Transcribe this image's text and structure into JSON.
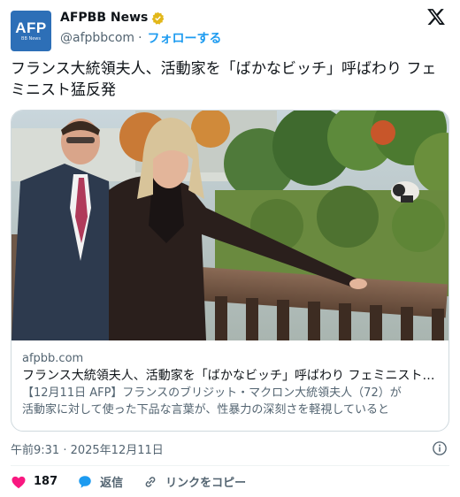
{
  "account": {
    "name": "AFPBB News",
    "handle": "@afpbbcom",
    "separator": "·",
    "follow_label": "フォローする",
    "avatar_text": "AFP",
    "avatar_subtext": "BB News"
  },
  "tweet": {
    "text": "フランス大統領夫人、活動家を「ばかなビッチ」呼ばわり フェミニスト猛反発"
  },
  "card": {
    "domain": "afpbb.com",
    "title": "フランス大統領夫人、活動家を「ばかなビッチ」呼ばわり フェミニスト猛反発",
    "description_line1": "【12月11日 AFP】フランスのブリジット・マクロン大統領夫人（72）が",
    "description_line2": "活動家に対して使った下品な言葉が、性暴力の深刻さを軽視していると"
  },
  "meta": {
    "time": "午前9:31 · 2025年12月11日"
  },
  "actions": {
    "like_count": "187",
    "reply_label": "返信",
    "copy_link_label": "リンクをコピー"
  },
  "colors": {
    "accent": "#1d9bf0",
    "like": "#f91880",
    "verified_gold": "#e2b719",
    "avatar_bg": "#2d6fb7"
  }
}
